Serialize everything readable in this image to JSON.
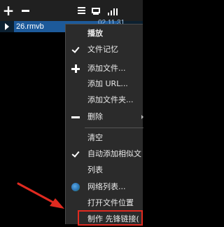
{
  "toolbar": {
    "add_icon": "plus-icon",
    "remove_icon": "minus-icon",
    "menu_icon": "menu-icon",
    "screen_icon": "monitor-icon",
    "list_icon": "list-icon"
  },
  "playlist": {
    "items": [
      {
        "name": "26.rmvb",
        "date": "02.11.31"
      }
    ]
  },
  "context_menu": {
    "items": [
      {
        "label": "播放",
        "bold": true
      },
      {
        "label": "文件记忆",
        "icon": "check-icon"
      },
      {
        "label": "添加文件...",
        "icon": "plus-icon"
      },
      {
        "label": "添加 URL..."
      },
      {
        "label": "添加文件夹..."
      },
      {
        "label": "删除",
        "icon": "minus-icon",
        "submenu": true
      },
      {
        "label": "清空"
      },
      {
        "label": "自动添加相似文",
        "icon": "check-icon"
      },
      {
        "label": "列表"
      },
      {
        "label": "网络列表...",
        "icon": "globe-icon"
      },
      {
        "label": "打开文件位置"
      },
      {
        "label": "制作 先锋链接(",
        "highlighted": true
      }
    ]
  },
  "colors": {
    "selection": "#1d5a9a",
    "annotation": "#e02a20"
  }
}
